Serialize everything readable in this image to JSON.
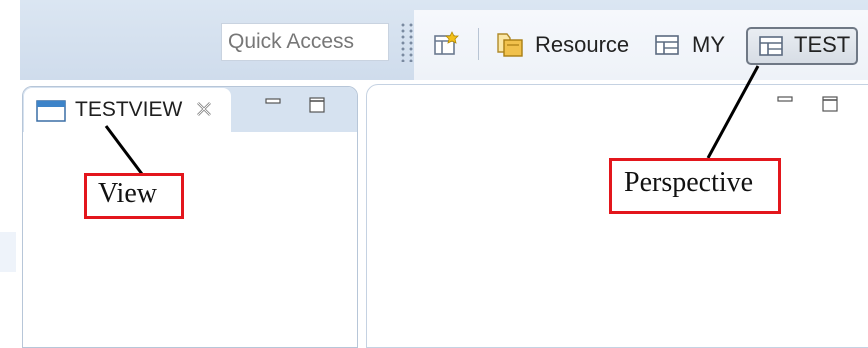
{
  "toolbar": {
    "quick_access_placeholder": "Quick Access",
    "perspectives": [
      {
        "label": "Resource",
        "icon": "resource-perspective-icon"
      },
      {
        "label": "MY",
        "icon": "perspective-icon"
      },
      {
        "label": "TEST",
        "icon": "perspective-icon",
        "active": true
      }
    ],
    "open_perspective_icon": "open-perspective-icon"
  },
  "view": {
    "tab_label": "TESTVIEW",
    "tab_icon": "view-icon",
    "close_icon": "close-icon",
    "buttons": [
      "minimize-icon",
      "maximize-icon"
    ]
  },
  "editor": {
    "buttons": [
      "minimize-icon",
      "maximize-icon"
    ]
  },
  "annotations": {
    "view_label": "View",
    "perspective_label": "Perspective",
    "box_color": "#e3161c"
  }
}
